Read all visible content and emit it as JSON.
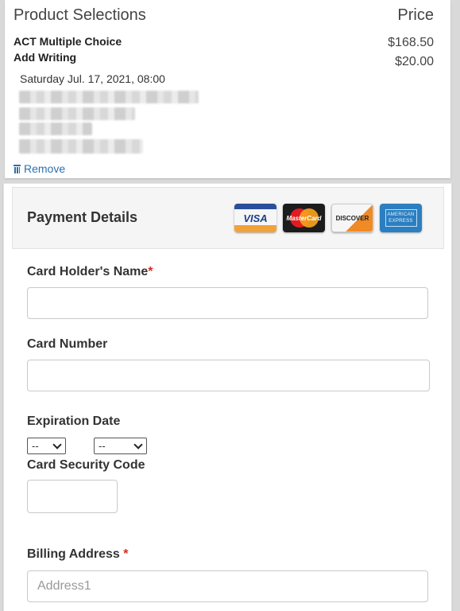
{
  "products": {
    "header_title": "Product Selections",
    "header_price": "Price",
    "items": [
      {
        "name": "ACT Multiple Choice",
        "price": "$168.50"
      },
      {
        "name": "Add Writing",
        "price": "$20.00"
      }
    ],
    "datetime": "Saturday Jul. 17, 2021, 08:00",
    "remove_label": "Remove",
    "remove_icon": "trash-icon"
  },
  "payment": {
    "title": "Payment Details",
    "cards": {
      "visa": "VISA",
      "mastercard": "MasterCard",
      "discover": "DISCOVER",
      "amex_line1": "AMERICAN",
      "amex_line2": "EXPRESS"
    },
    "card_holder_label": "Card Holder's Name",
    "required_mark": "*",
    "card_holder_value": "",
    "card_number_label": "Card Number",
    "card_number_value": "",
    "expiration_label": "Expiration Date",
    "exp_month_value": "--",
    "exp_year_value": "--",
    "security_code_label": "Card Security Code",
    "security_code_value": "",
    "billing_label": "Billing Address ",
    "address1_placeholder": "Address1"
  },
  "colors": {
    "link": "#2d6fb0",
    "required": "#d9281e",
    "panel_header_bg": "#f5f5f5"
  }
}
